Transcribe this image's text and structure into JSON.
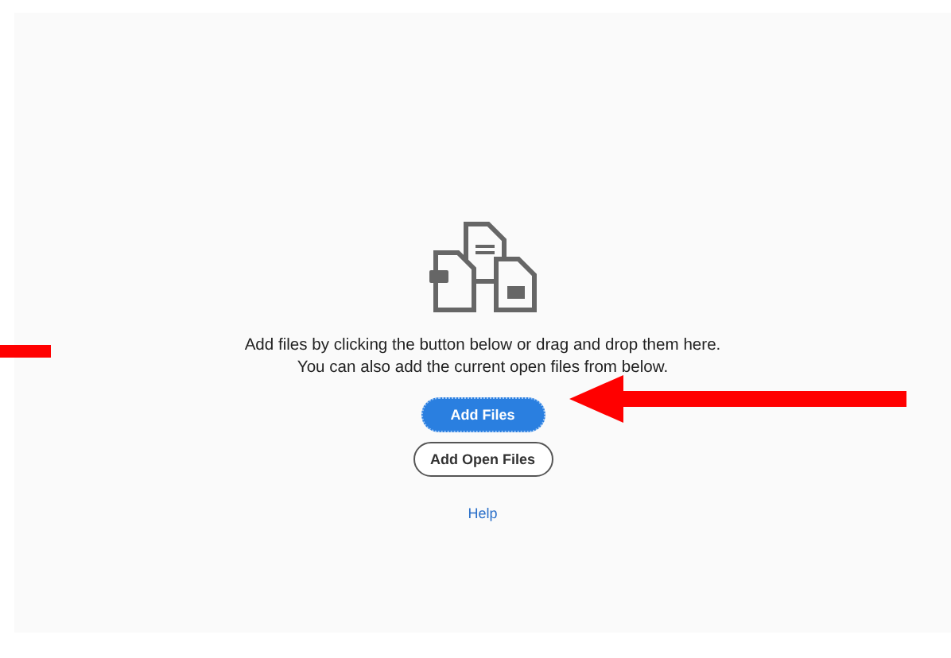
{
  "message": [
    "Add files by clicking the button below or drag and drop them here.",
    "You can also add the current open files from below."
  ],
  "buttons": [
    {
      "label": "Add Files",
      "kind": "primary"
    },
    {
      "label": "Add Open Files",
      "kind": "secondary"
    }
  ],
  "help_link": "Help"
}
